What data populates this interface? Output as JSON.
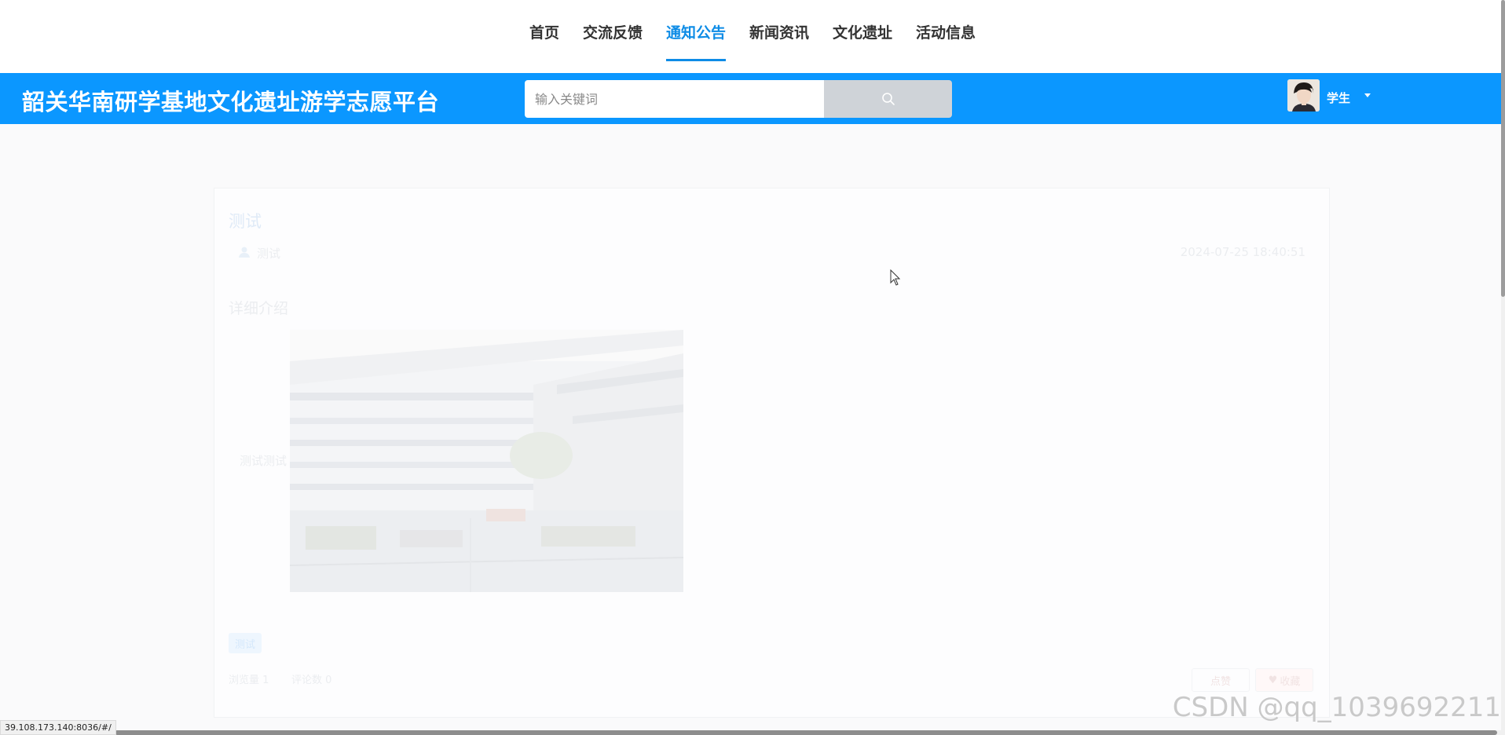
{
  "nav": {
    "items": [
      {
        "label": "首页"
      },
      {
        "label": "交流反馈"
      },
      {
        "label": "通知公告",
        "active": true
      },
      {
        "label": "新闻资讯"
      },
      {
        "label": "文化遗址"
      },
      {
        "label": "活动信息"
      }
    ],
    "active_color": "#0e8ce6"
  },
  "header": {
    "site_title": "韶关华南研学基地文化遗址游学志愿平台",
    "bar_color": "#0b97ff",
    "search": {
      "placeholder": "输入关键词",
      "value": "",
      "button_icon": "search-icon"
    },
    "user": {
      "name": "学生",
      "avatar_icon": "avatar-image",
      "caret_icon": "caret-down-icon"
    }
  },
  "notice": {
    "title": "测试",
    "author": "测试",
    "time": "2024-07-25 18:40:51",
    "section_heading": "详细介绍",
    "side_label": "测试测试",
    "tag": "测试",
    "views_label": "浏览量",
    "views_value": "1",
    "comments_label": "评论数",
    "comments_value": "0",
    "like_label": "点赞",
    "favorite_label": "收藏"
  },
  "statusbar": {
    "url": "39.108.173.140:8036/#/"
  },
  "watermark": "CSDN @qq_1039692211"
}
